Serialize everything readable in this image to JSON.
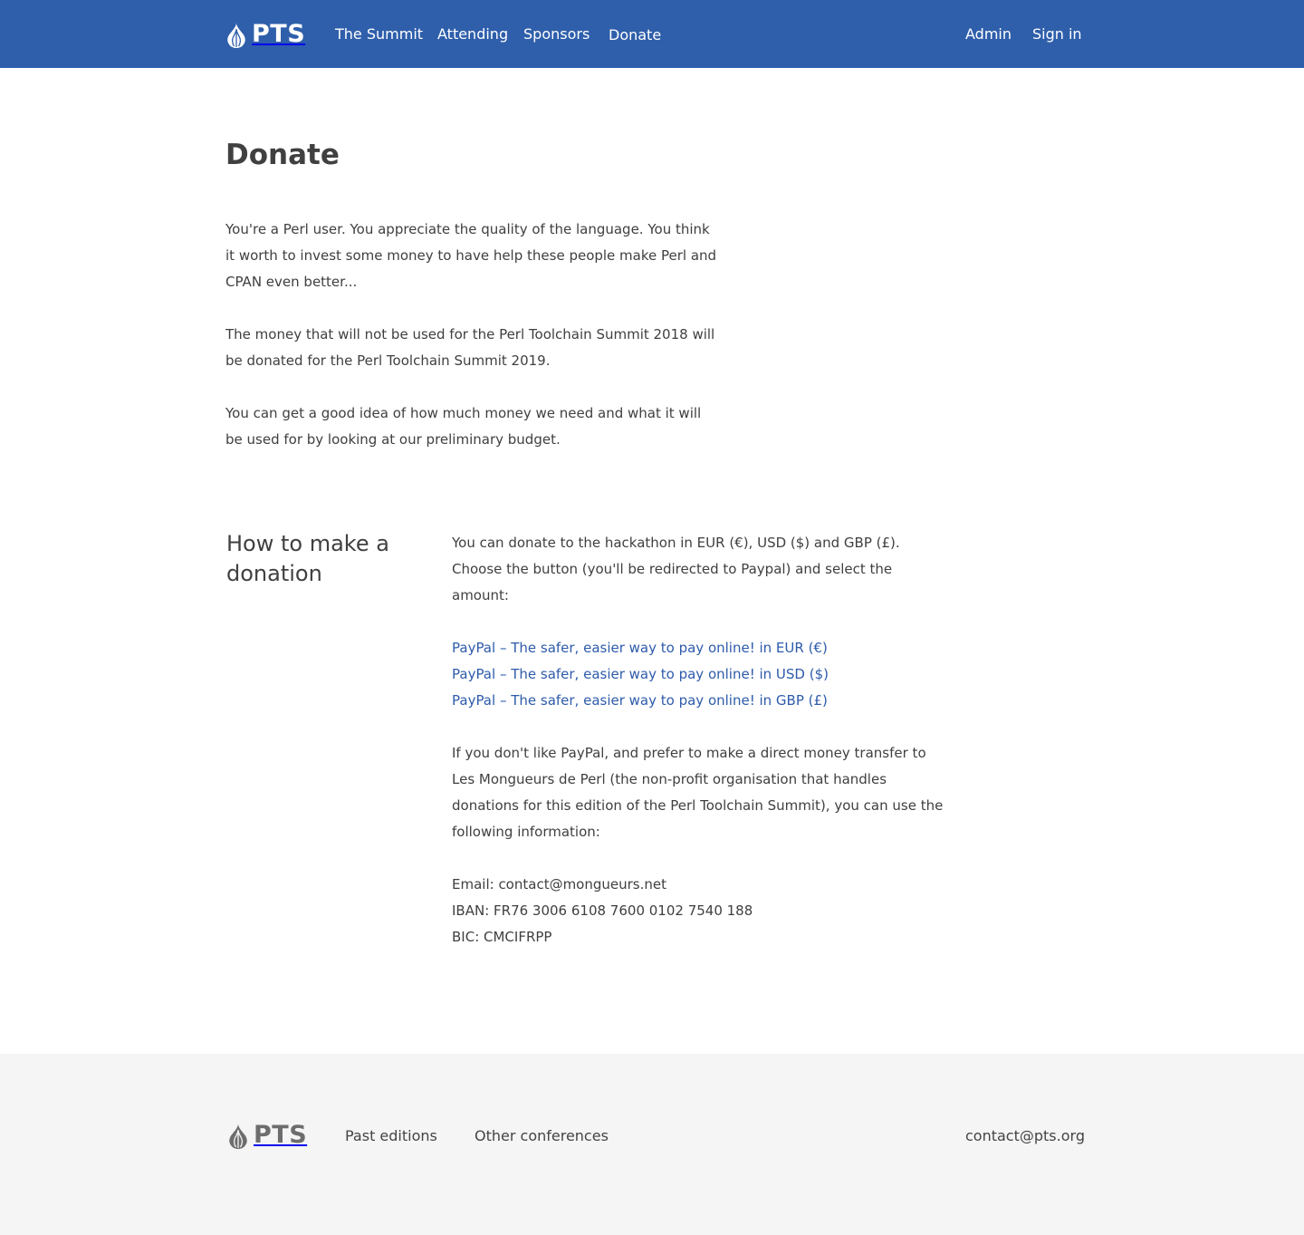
{
  "header": {
    "logo_text": "PTS",
    "nav": {
      "summit": "The Summit",
      "attending": "Attending",
      "sponsors": "Sponsors",
      "donate": "Donate"
    },
    "admin": "Admin",
    "sign_in": "Sign in"
  },
  "page": {
    "title": "Donate",
    "intro": [
      "You're a Perl user. You appreciate the quality of the language. You think it worth to invest some money to have help these people make Perl and CPAN even better...",
      "The money that will not be used for the Perl Toolchain Summit 2018 will be donated for the Perl Toolchain Summit 2019.",
      "You can get a good idea of how much money we need and what it will be used for by looking at our preliminary budget."
    ]
  },
  "donation": {
    "heading": "How to make a donation",
    "instructions": "You can donate to the hackathon in EUR (€), USD ($) and GBP (£). Choose the button (you'll be redirected to Paypal) and select the amount:",
    "paypal_links": [
      "PayPal – The safer, easier way to pay online! in EUR (€)",
      "PayPal – The safer, easier way to pay online! in USD ($)",
      "PayPal – The safer, easier way to pay online! in GBP (£)"
    ],
    "transfer_text": "If you don't like PayPal, and prefer to make a direct money transfer to Les Mongueurs de Perl (the non-profit organisation that handles donations for this edition of the Perl Toolchain Summit), you can use the following information:",
    "bank": {
      "email": "Email: contact@mongueurs.net",
      "iban": "IBAN: FR76 3006 6108 7600 0102 7540 188",
      "bic": "BIC: CMCIFRPP"
    }
  },
  "footer": {
    "logo_text": "PTS",
    "past_editions": "Past editions",
    "other_conferences": "Other conferences",
    "contact": "contact@pts.org"
  },
  "colors": {
    "header_bg": "#2f5fab",
    "link": "#2e5bab",
    "footer_bg": "#f5f5f5",
    "text": "#3f3f3f"
  },
  "icons": {
    "logo": "onion-icon"
  }
}
